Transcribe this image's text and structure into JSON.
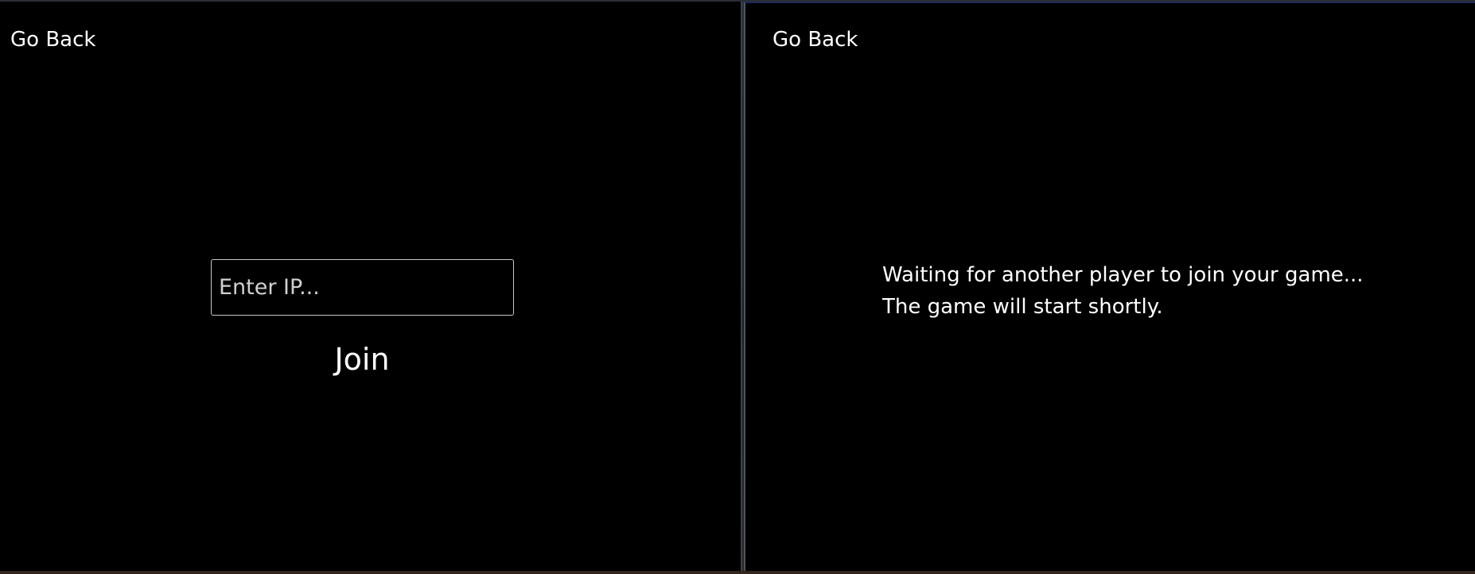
{
  "join_window": {
    "go_back_label": "Go Back",
    "ip_input": {
      "value": "",
      "placeholder": "Enter IP..."
    },
    "join_label": "Join"
  },
  "host_window": {
    "go_back_label": "Go Back",
    "status_line_1": "Waiting for another player to join your game...",
    "status_line_2": "The game will start shortly."
  },
  "colors": {
    "window_background": "#000000",
    "text": "#ffffff",
    "input_border": "#c8c8c8"
  }
}
